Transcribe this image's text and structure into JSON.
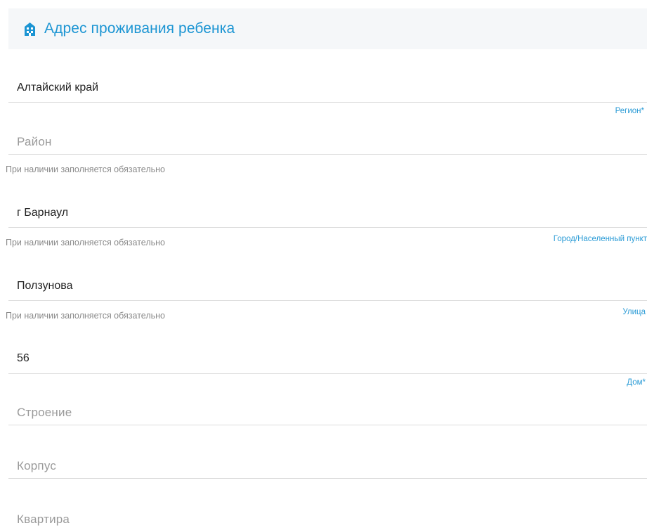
{
  "header": {
    "icon": "building-icon",
    "title": "Адрес проживания ребенка",
    "accent_color": "#1c95d3"
  },
  "hint_text": "При наличии заполняется обязательно",
  "fields": {
    "region": {
      "value": "Алтайский край",
      "label": "Регион*"
    },
    "district": {
      "placeholder": "Район"
    },
    "city": {
      "value": "г Барнаул",
      "label": "Город/Населенный пункт"
    },
    "street": {
      "value": "Ползунова",
      "label": "Улица"
    },
    "house": {
      "value": "56",
      "label": "Дом*"
    },
    "building": {
      "placeholder": "Строение"
    },
    "block": {
      "placeholder": "Корпус"
    },
    "apartment": {
      "placeholder": "Квартира"
    }
  }
}
